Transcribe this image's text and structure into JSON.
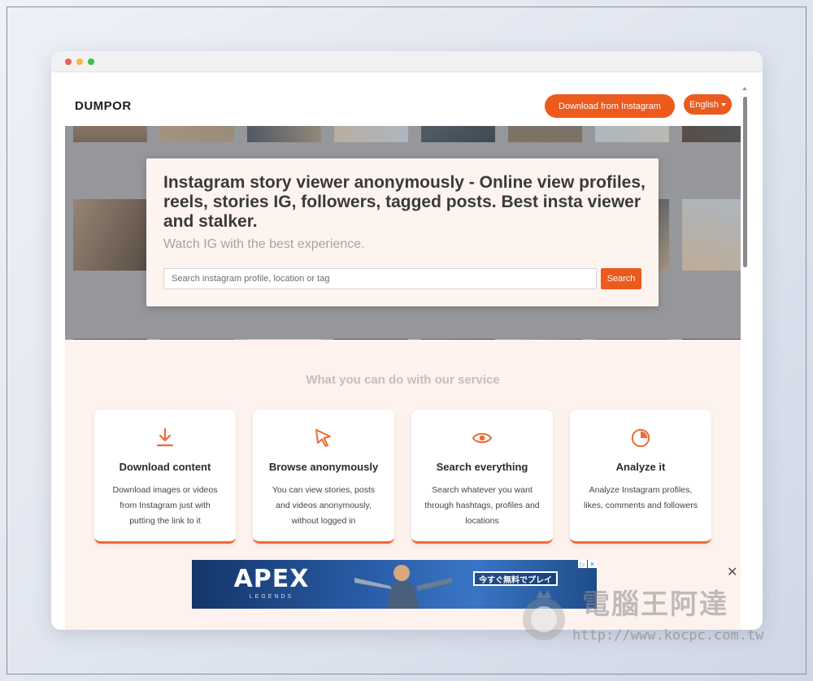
{
  "site": {
    "brand": "DUMPOR",
    "download_button": "Download from Instagram",
    "language": "English"
  },
  "hero": {
    "title": "Instagram story viewer anonymously - Online view profiles, reels, stories IG, followers, tagged posts. Best insta viewer and stalker.",
    "subtitle": "Watch IG with the best experience.",
    "search_placeholder": "Search instagram profile, location or tag",
    "search_button": "Search"
  },
  "features": {
    "heading": "What you can do with our service",
    "items": [
      {
        "icon": "download-icon",
        "title": "Download content",
        "desc": "Download images or videos from Instagram just with putting the link to it"
      },
      {
        "icon": "cursor-icon",
        "title": "Browse anonymously",
        "desc": "You can view stories, posts and videos anonymously, without logged in"
      },
      {
        "icon": "eye-icon",
        "title": "Search everything",
        "desc": "Search whatever you want through hashtags, profiles and locations"
      },
      {
        "icon": "pie-chart-icon",
        "title": "Analyze it",
        "desc": "Analyze Instagram profiles, likes, comments and followers"
      }
    ]
  },
  "ad": {
    "brand": "APEX",
    "subbrand": "LEGENDS",
    "cta": "今すぐ無料でプレイ",
    "close": "✕"
  },
  "watermark": {
    "name": "電腦王阿達",
    "url": "http://www.kocpc.com.tw"
  },
  "colors": {
    "accent": "#ec5a1d",
    "feature_bg": "#fdf2ed",
    "card_border": "#ec6a34"
  }
}
